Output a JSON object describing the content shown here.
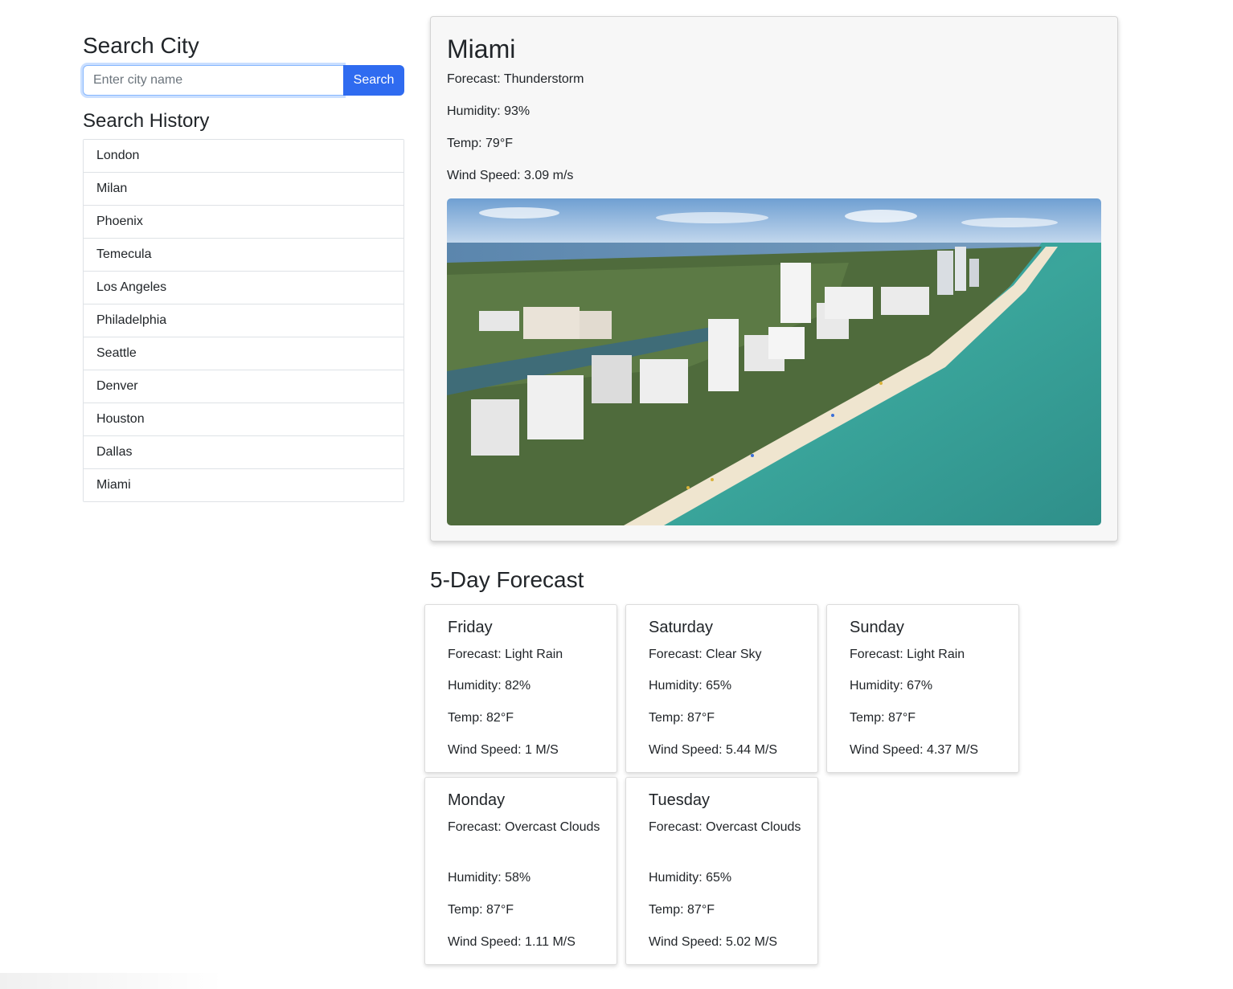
{
  "search": {
    "heading": "Search City",
    "placeholder": "Enter city name",
    "value": "",
    "button_label": "Search"
  },
  "history": {
    "heading": "Search History",
    "items": [
      "London",
      "Milan",
      "Phoenix",
      "Temecula",
      "Los Angeles",
      "Philadelphia",
      "Seattle",
      "Denver",
      "Houston",
      "Dallas",
      "Miami"
    ]
  },
  "current": {
    "city": "Miami",
    "forecast": "Forecast: Thunderstorm",
    "humidity": "Humidity: 93%",
    "temp": "Temp: 79°F",
    "wind": "Wind Speed: 3.09 m/s"
  },
  "forecast": {
    "title": "5-Day Forecast",
    "days": [
      {
        "day": "Friday",
        "forecast": "Forecast: Light Rain",
        "humidity": "Humidity: 82%",
        "temp": "Temp: 82°F",
        "wind": "Wind Speed: 1 M/S"
      },
      {
        "day": "Saturday",
        "forecast": "Forecast: Clear Sky",
        "humidity": "Humidity: 65%",
        "temp": "Temp: 87°F",
        "wind": "Wind Speed: 5.44 M/S"
      },
      {
        "day": "Sunday",
        "forecast": "Forecast: Light Rain",
        "humidity": "Humidity: 67%",
        "temp": "Temp: 87°F",
        "wind": "Wind Speed: 4.37 M/S"
      },
      {
        "day": "Monday",
        "forecast": "Forecast: Overcast Clouds",
        "humidity": "Humidity: 58%",
        "temp": "Temp: 87°F",
        "wind": "Wind Speed: 1.11 M/S"
      },
      {
        "day": "Tuesday",
        "forecast": "Forecast: Overcast Clouds",
        "humidity": "Humidity: 65%",
        "temp": "Temp: 87°F",
        "wind": "Wind Speed: 5.02 M/S"
      }
    ]
  },
  "colors": {
    "accent": "#2f6bf0",
    "card_background": "#f7f7f7",
    "border": "#dee2e6"
  }
}
